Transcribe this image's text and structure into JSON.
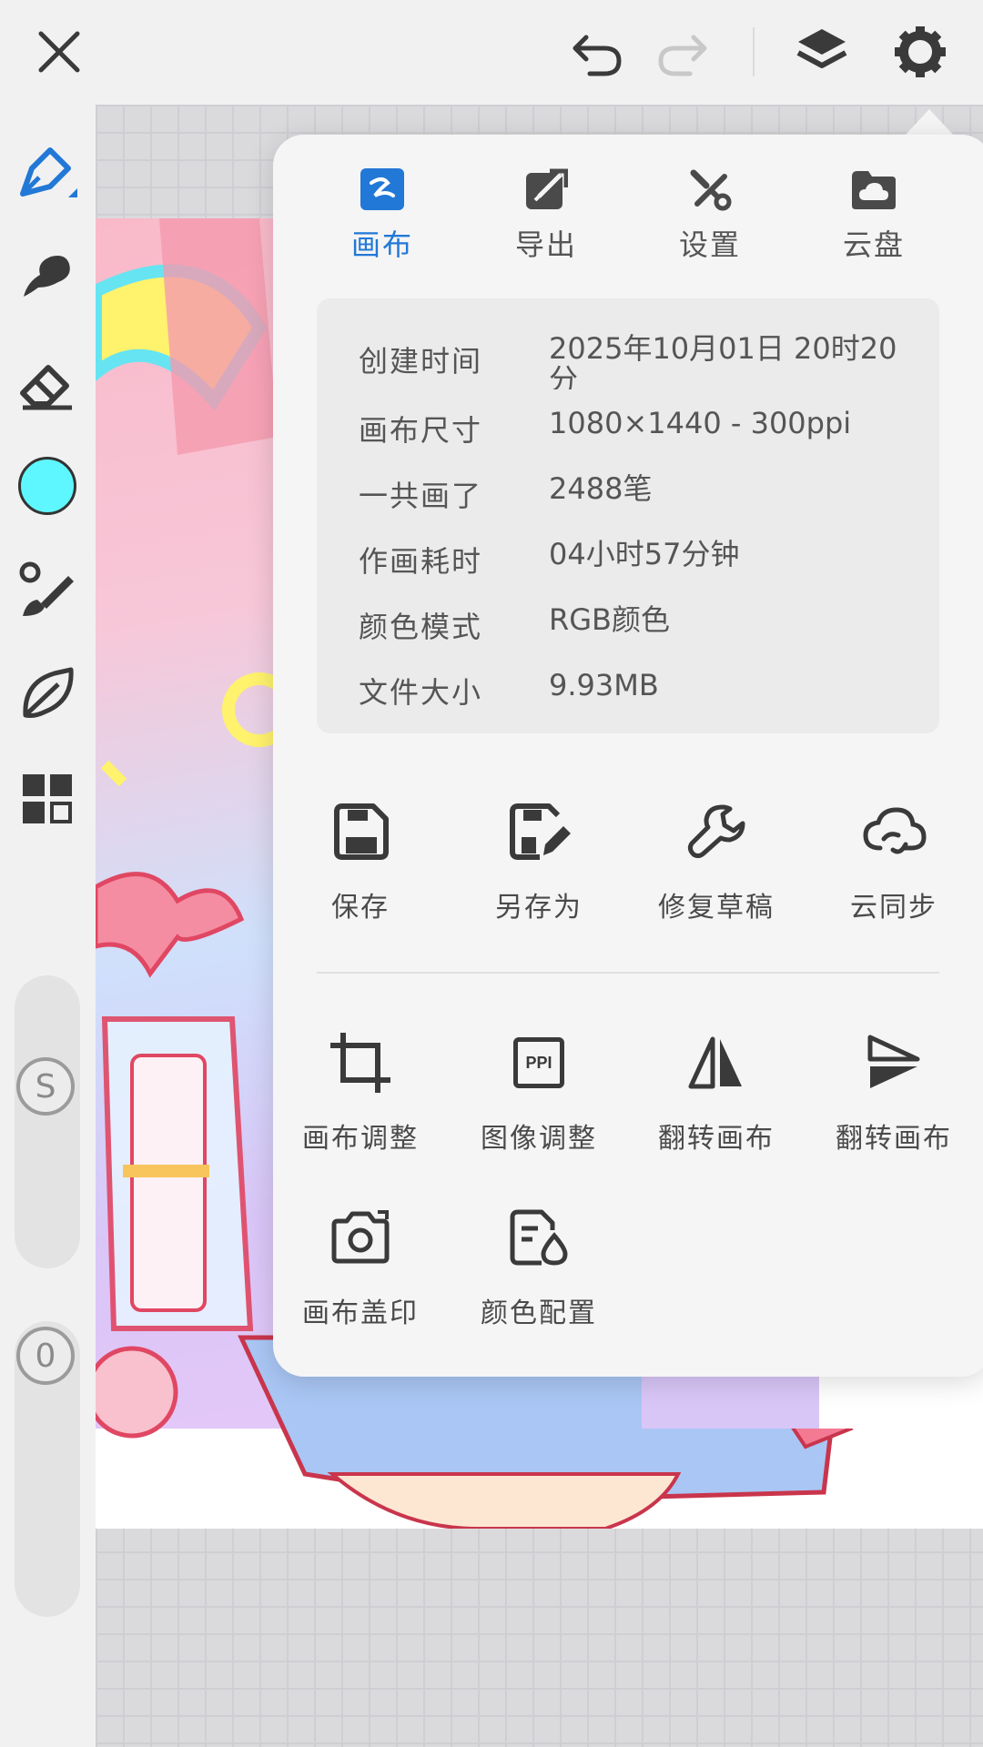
{
  "popover": {
    "tabs": [
      {
        "label": "画布",
        "icon": "canvas-icon",
        "active": true
      },
      {
        "label": "导出",
        "icon": "export-icon",
        "active": false
      },
      {
        "label": "设置",
        "icon": "settings-tools-icon",
        "active": false
      },
      {
        "label": "云盘",
        "icon": "cloud-drive-icon",
        "active": false
      }
    ],
    "info": [
      {
        "key": "创建时间",
        "value": "2025年10月01日 20时20分"
      },
      {
        "key": "画布尺寸",
        "value": "1080×1440 - 300ppi"
      },
      {
        "key": "一共画了",
        "value": "2488笔"
      },
      {
        "key": "作画耗时",
        "value": "04小时57分钟"
      },
      {
        "key": "颜色模式",
        "value": "RGB颜色"
      },
      {
        "key": "文件大小",
        "value": "9.93MB"
      }
    ],
    "actions_row1": [
      {
        "label": "保存",
        "icon": "save-icon"
      },
      {
        "label": "另存为",
        "icon": "save-as-icon"
      },
      {
        "label": "修复草稿",
        "icon": "wrench-icon"
      },
      {
        "label": "云同步",
        "icon": "cloud-sync-icon"
      }
    ],
    "actions_row2": [
      {
        "label": "画布调整",
        "icon": "crop-icon"
      },
      {
        "label": "图像调整",
        "icon": "ppi-icon",
        "icon_text": "PPI"
      },
      {
        "label": "翻转画布",
        "icon": "flip-horizontal-icon"
      },
      {
        "label": "翻转画布",
        "icon": "flip-vertical-icon"
      }
    ],
    "actions_row3": [
      {
        "label": "画布盖印",
        "icon": "camera-icon"
      },
      {
        "label": "颜色配置",
        "icon": "color-config-icon"
      }
    ]
  },
  "toolbar": {
    "current_color": "#5ff7ff",
    "size_knob_label": "S",
    "opacity_knob_label": "0"
  },
  "colors": {
    "accent": "#2278d6",
    "icon": "#3a3a3a",
    "disabled": "#c8c8c8"
  }
}
